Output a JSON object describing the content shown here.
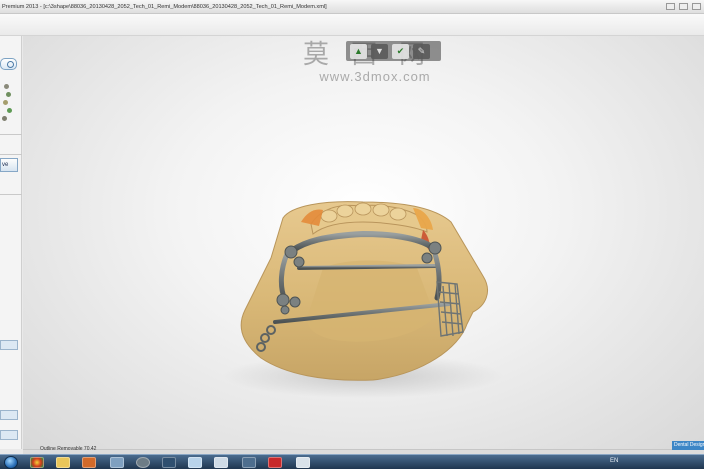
{
  "window": {
    "title": "Premium 2013 - [c:\\3shape\\88036_20130428_2052_Tech_01_Remi_Modem\\88036_20130428_2052_Tech_01_Remi_Modem.xml]"
  },
  "watermark": {
    "cn_text": "莫西网",
    "url_text": "www.3dmox.com"
  },
  "view_toolbar": {
    "buttons": [
      "view-up-icon",
      "view-down-icon",
      "accept-check-icon",
      "tools-icon"
    ]
  },
  "left_panel": {
    "tab_label": "ve"
  },
  "status": {
    "text": "Outline Removable 70.42",
    "corner_badge": "Dental Designer"
  },
  "taskbar": {
    "lang": "EN",
    "icons": [
      "chrome-icon",
      "folder-icon",
      "media-icon",
      "network-icon",
      "disc-icon",
      "app-icon",
      "word-icon",
      "window-icon",
      "mail-icon",
      "image-icon",
      "red-app-icon",
      "monitor-icon"
    ]
  }
}
